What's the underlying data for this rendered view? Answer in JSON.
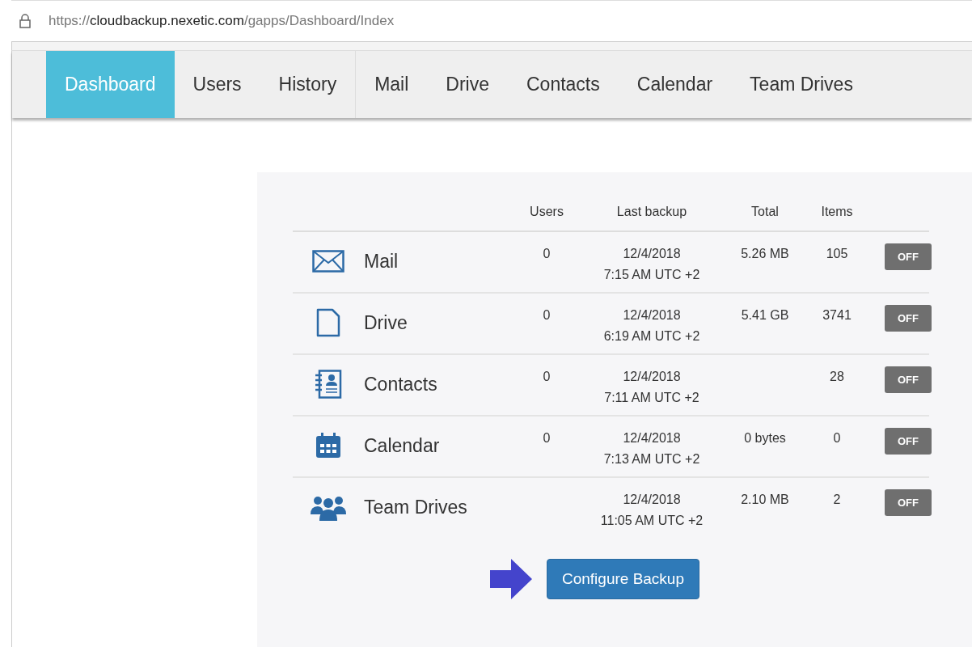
{
  "address_bar": {
    "scheme": "https://",
    "host": "cloudbackup.nexetic.com",
    "path": "/gapps/Dashboard/Index"
  },
  "nav_groups": [
    [
      {
        "label": "Dashboard",
        "selected": true
      },
      {
        "label": "Users",
        "selected": false
      },
      {
        "label": "History",
        "selected": false
      }
    ],
    [
      {
        "label": "Mail",
        "selected": false
      },
      {
        "label": "Drive",
        "selected": false
      },
      {
        "label": "Contacts",
        "selected": false
      },
      {
        "label": "Calendar",
        "selected": false
      },
      {
        "label": "Team Drives",
        "selected": false
      }
    ]
  ],
  "table": {
    "columns": [
      "Users",
      "Last backup",
      "Total",
      "Items"
    ],
    "rows": [
      {
        "kind": "mail",
        "name": "Mail",
        "users": "0",
        "date": "12/4/2018",
        "time": "7:15 AM UTC +2",
        "total": "5.26 MB",
        "items": "105",
        "toggle": "OFF",
        "on": false
      },
      {
        "kind": "drive",
        "name": "Drive",
        "users": "0",
        "date": "12/4/2018",
        "time": "6:19 AM UTC +2",
        "total": "5.41 GB",
        "items": "3741",
        "toggle": "OFF",
        "on": false
      },
      {
        "kind": "contacts",
        "name": "Contacts",
        "users": "0",
        "date": "12/4/2018",
        "time": "7:11 AM UTC +2",
        "total": "",
        "items": "28",
        "toggle": "OFF",
        "on": false
      },
      {
        "kind": "calendar",
        "name": "Calendar",
        "users": "0",
        "date": "12/4/2018",
        "time": "7:13 AM UTC +2",
        "total": "0 bytes",
        "items": "0",
        "toggle": "OFF",
        "on": false
      },
      {
        "kind": "team",
        "name": "Team Drives",
        "users": "",
        "date": "12/4/2018",
        "time": "11:05 AM UTC +2",
        "total": "2.10 MB",
        "items": "2",
        "toggle": "OFF",
        "on": false
      }
    ]
  },
  "configure_button": "Configure Backup"
}
